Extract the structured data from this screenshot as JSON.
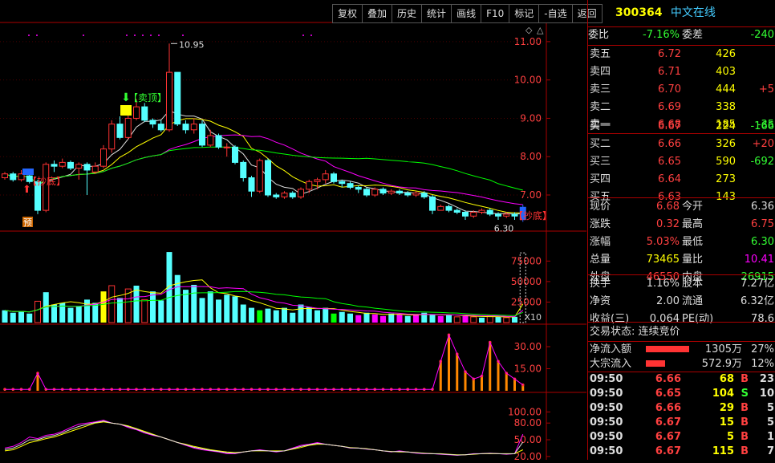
{
  "toolbar": {
    "buttons": [
      "复权",
      "叠加",
      "历史",
      "统计",
      "画线",
      "F10",
      "标记",
      "-自选",
      "返回"
    ]
  },
  "stock": {
    "code": "300364",
    "name": "中文在线"
  },
  "quote": {
    "weibi_label": "委比",
    "weibi_value": "-7.16%",
    "weicha_label": "委差",
    "weicha_value": "-240",
    "asks": [
      {
        "label": "卖五",
        "price": "6.72",
        "volume": "426",
        "change": ""
      },
      {
        "label": "卖四",
        "price": "6.71",
        "volume": "403",
        "change": ""
      },
      {
        "label": "卖三",
        "price": "6.70",
        "volume": "444",
        "change": "+5"
      },
      {
        "label": "卖二",
        "price": "6.69",
        "volume": "338",
        "change": ""
      },
      {
        "label": "卖一",
        "price": "6.68",
        "volume": "185",
        "change": "-35"
      }
    ],
    "bids": [
      {
        "label": "买一",
        "price": "6.67",
        "volume": "224",
        "change": "-166"
      },
      {
        "label": "买二",
        "price": "6.66",
        "volume": "326",
        "change": "+20"
      },
      {
        "label": "买三",
        "price": "6.65",
        "volume": "590",
        "change": "-692"
      },
      {
        "label": "买四",
        "price": "6.64",
        "volume": "273",
        "change": ""
      },
      {
        "label": "买五",
        "price": "6.63",
        "volume": "143",
        "change": ""
      }
    ],
    "stats": [
      {
        "l1": "现价",
        "v1": "6.68",
        "l2": "今开",
        "v2": "6.36"
      },
      {
        "l1": "涨跌",
        "v1": "0.32",
        "l2": "最高",
        "v2": "6.75"
      },
      {
        "l1": "涨幅",
        "v1": "5.03%",
        "l2": "最低",
        "v2": "6.30"
      },
      {
        "l1": "总量",
        "v1": "73465",
        "l2": "量比",
        "v2": "10.41"
      },
      {
        "l1": "外盘",
        "v1": "46550",
        "l2": "内盘",
        "v2": "26915"
      }
    ],
    "fund": [
      {
        "l1": "换手",
        "v1": "1.16%",
        "l2": "股本",
        "v2": "7.27亿"
      },
      {
        "l1": "净资",
        "v1": "2.00",
        "l2": "流通",
        "v2": "6.32亿"
      },
      {
        "l1": "收益(三)",
        "v1": "0.064",
        "l2": "PE(动)",
        "v2": "78.6"
      }
    ],
    "trade_status": "交易状态: 连续竞价",
    "net_inflow_label": "净流入额",
    "net_inflow_value": "1305万",
    "net_inflow_pct": "27%",
    "block_inflow_label": "大宗流入",
    "block_inflow_value": "572.9万",
    "block_inflow_pct": "12%",
    "ticks": [
      {
        "time": "09:50",
        "price": "6.66",
        "volume": "68",
        "side": "B",
        "count": "23"
      },
      {
        "time": "09:50",
        "price": "6.65",
        "volume": "104",
        "side": "S",
        "count": "10"
      },
      {
        "time": "09:50",
        "price": "6.66",
        "volume": "29",
        "side": "B",
        "count": "5"
      },
      {
        "time": "09:50",
        "price": "6.67",
        "volume": "15",
        "side": "B",
        "count": "5"
      },
      {
        "time": "09:50",
        "price": "6.67",
        "volume": "5",
        "side": "B",
        "count": "1"
      },
      {
        "time": "09:50",
        "price": "6.67",
        "volume": "115",
        "side": "B",
        "count": "7"
      }
    ]
  },
  "chart_data": {
    "type": "candlestick",
    "price_ticks": [
      "11.00",
      "10.00",
      "9.00",
      "8.00",
      "7.00"
    ],
    "price_tick_values": [
      11,
      10,
      9,
      8,
      7
    ],
    "price_range": [
      6.1,
      11.5
    ],
    "volume_ticks": [
      "75000",
      "50000",
      "25000"
    ],
    "volume_tick_values": [
      75000,
      50000,
      25000
    ],
    "volume_range": [
      0,
      90000
    ],
    "volume_unit": "X10",
    "flow_ticks": [
      "30.00",
      "15.00"
    ],
    "flow_tick_values": [
      30,
      15
    ],
    "flow_range": [
      0,
      42
    ],
    "osc_ticks": [
      "100.00",
      "80.00",
      "50.00",
      "20.00"
    ],
    "osc_tick_values": [
      100,
      80,
      50,
      20
    ],
    "osc_range": [
      14,
      112
    ],
    "annotations": {
      "high": "10.95",
      "low": "6.30",
      "sell_top": "【卖顶】",
      "buy_bottom_left": "【抄底】",
      "buy_bottom_right": "【抄底】",
      "yu": "预"
    },
    "candles": [
      [
        7.45,
        7.55,
        7.6,
        7.4
      ],
      [
        7.55,
        7.4,
        7.6,
        7.35
      ],
      [
        7.4,
        7.55,
        7.65,
        7.35
      ],
      [
        7.5,
        7.35,
        7.55,
        7.3
      ],
      [
        7.35,
        6.6,
        7.4,
        6.5
      ],
      [
        6.6,
        7.8,
        7.85,
        6.55
      ],
      [
        7.8,
        7.75,
        7.9,
        7.6
      ],
      [
        7.75,
        7.85,
        7.95,
        7.7
      ],
      [
        7.85,
        7.7,
        7.9,
        7.65
      ],
      [
        7.7,
        7.8,
        7.85,
        7.4
      ],
      [
        7.8,
        7.65,
        7.85,
        7.0
      ],
      [
        7.6,
        7.75,
        7.85,
        7.55
      ],
      [
        7.75,
        8.2,
        8.3,
        7.7
      ],
      [
        8.2,
        8.85,
        8.95,
        8.1
      ],
      [
        8.85,
        8.5,
        9.05,
        8.45
      ],
      [
        8.5,
        9.0,
        9.1,
        8.45
      ],
      [
        9.0,
        9.3,
        9.5,
        8.95
      ],
      [
        9.3,
        8.95,
        9.4,
        8.9
      ],
      [
        8.95,
        8.85,
        9.0,
        8.75
      ],
      [
        8.85,
        8.7,
        8.95,
        8.65
      ],
      [
        8.7,
        10.2,
        10.95,
        8.65
      ],
      [
        10.2,
        8.85,
        10.2,
        8.8
      ],
      [
        8.85,
        8.7,
        8.95,
        8.6
      ],
      [
        8.7,
        8.85,
        9.0,
        8.6
      ],
      [
        8.85,
        8.3,
        8.95,
        8.25
      ],
      [
        8.3,
        8.55,
        8.7,
        8.25
      ],
      [
        8.55,
        8.25,
        8.6,
        8.2
      ],
      [
        8.25,
        8.25,
        8.35,
        8.0
      ],
      [
        8.25,
        7.85,
        8.3,
        7.8
      ],
      [
        7.85,
        7.45,
        7.9,
        7.35
      ],
      [
        7.45,
        7.1,
        7.5,
        6.95
      ],
      [
        7.1,
        7.9,
        7.95,
        7.05
      ],
      [
        7.9,
        7.0,
        7.95,
        6.95
      ],
      [
        7.0,
        6.95,
        7.05,
        6.9
      ],
      [
        6.95,
        7.05,
        7.1,
        6.9
      ],
      [
        7.05,
        6.95,
        7.1,
        6.9
      ],
      [
        6.95,
        7.15,
        7.2,
        6.9
      ],
      [
        7.15,
        7.35,
        7.4,
        7.05
      ],
      [
        7.35,
        7.4,
        7.45,
        7.15
      ],
      [
        7.4,
        7.55,
        7.65,
        7.3
      ],
      [
        7.55,
        7.35,
        7.6,
        7.3
      ],
      [
        7.35,
        7.3,
        7.4,
        7.2
      ],
      [
        7.3,
        7.2,
        7.35,
        7.15
      ],
      [
        7.2,
        7.15,
        7.25,
        7.05
      ],
      [
        7.15,
        7.0,
        7.2,
        6.95
      ],
      [
        7.0,
        7.15,
        7.2,
        6.95
      ],
      [
        7.15,
        7.05,
        7.2,
        7.0
      ],
      [
        7.05,
        7.1,
        7.15,
        7.0
      ],
      [
        7.1,
        7.05,
        7.15,
        7.0
      ],
      [
        7.05,
        7.0,
        7.1,
        6.95
      ],
      [
        7.0,
        7.05,
        7.1,
        6.95
      ],
      [
        7.05,
        6.95,
        7.1,
        6.9
      ],
      [
        6.95,
        6.6,
        7.0,
        6.5
      ],
      [
        6.6,
        6.7,
        6.75,
        6.6
      ],
      [
        6.7,
        6.6,
        6.75,
        6.55
      ],
      [
        6.6,
        6.55,
        6.65,
        6.5
      ],
      [
        6.55,
        6.45,
        6.6,
        6.35
      ],
      [
        6.45,
        6.55,
        6.6,
        6.4
      ],
      [
        6.55,
        6.6,
        6.65,
        6.5
      ],
      [
        6.6,
        6.5,
        6.65,
        6.45
      ],
      [
        6.5,
        6.45,
        6.55,
        6.35
      ],
      [
        6.45,
        6.5,
        6.55,
        6.4
      ],
      [
        6.5,
        6.45,
        6.55,
        6.35
      ],
      [
        6.36,
        6.68,
        6.75,
        6.3
      ]
    ],
    "volumes": [
      [
        15000,
        "c"
      ],
      [
        12000,
        "c"
      ],
      [
        14000,
        "c"
      ],
      [
        11000,
        "c"
      ],
      [
        26000,
        "r"
      ],
      [
        37000,
        "c"
      ],
      [
        22000,
        "c"
      ],
      [
        24000,
        "c"
      ],
      [
        18000,
        "c"
      ],
      [
        20000,
        "c"
      ],
      [
        28000,
        "c"
      ],
      [
        24000,
        "c"
      ],
      [
        38000,
        "y"
      ],
      [
        45000,
        "r"
      ],
      [
        30000,
        "c"
      ],
      [
        41000,
        "r"
      ],
      [
        45000,
        "c"
      ],
      [
        28000,
        "r"
      ],
      [
        38000,
        "c"
      ],
      [
        27000,
        "c"
      ],
      [
        86000,
        "c"
      ],
      [
        58000,
        "c"
      ],
      [
        40000,
        "c"
      ],
      [
        46000,
        "c"
      ],
      [
        30000,
        "c"
      ],
      [
        38000,
        "c"
      ],
      [
        28000,
        "c"
      ],
      [
        34000,
        "c"
      ],
      [
        32000,
        "c"
      ],
      [
        22000,
        "c"
      ],
      [
        18000,
        "c"
      ],
      [
        15000,
        "g"
      ],
      [
        17000,
        "c"
      ],
      [
        15000,
        "c"
      ],
      [
        18000,
        "c"
      ],
      [
        12000,
        "c"
      ],
      [
        22000,
        "c"
      ],
      [
        19000,
        "c"
      ],
      [
        15000,
        "c"
      ],
      [
        18000,
        "c"
      ],
      [
        11000,
        "g"
      ],
      [
        13000,
        "c"
      ],
      [
        11000,
        "c"
      ],
      [
        9000,
        "m"
      ],
      [
        12000,
        "c"
      ],
      [
        10000,
        "m"
      ],
      [
        8000,
        "m"
      ],
      [
        11000,
        "c"
      ],
      [
        10000,
        "m"
      ],
      [
        8000,
        "c"
      ],
      [
        9000,
        "m"
      ],
      [
        12000,
        "c"
      ],
      [
        10000,
        "c"
      ],
      [
        8000,
        "m"
      ],
      [
        9000,
        "c"
      ],
      [
        7000,
        "r"
      ],
      [
        8000,
        "m"
      ],
      [
        7000,
        "r"
      ],
      [
        6000,
        "c"
      ],
      [
        8000,
        "r"
      ],
      [
        7000,
        "c"
      ],
      [
        6000,
        "r"
      ],
      [
        7000,
        "c"
      ],
      [
        85000,
        "box"
      ]
    ],
    "flow": [
      1,
      1,
      1,
      1,
      12,
      1,
      1,
      1,
      1,
      1,
      1,
      1,
      1,
      1,
      1,
      1,
      1,
      1,
      1,
      1,
      1,
      1,
      1,
      1,
      1,
      1,
      1,
      1,
      1,
      1,
      1,
      1,
      1,
      1,
      1,
      1,
      1,
      1,
      1,
      1,
      1,
      1,
      1,
      1,
      1,
      1,
      1,
      1,
      1,
      1,
      1,
      1,
      1,
      20,
      38,
      25,
      13,
      8,
      10,
      33,
      20,
      12,
      8,
      4,
      2,
      22
    ],
    "osc_k": [
      35,
      38,
      45,
      55,
      52,
      58,
      60,
      65,
      72,
      78,
      80,
      82,
      85,
      80,
      78,
      72,
      68,
      62,
      58,
      55,
      50,
      45,
      40,
      35,
      32,
      30,
      28,
      25,
      25,
      28,
      30,
      32,
      30,
      28,
      30,
      35,
      40,
      42,
      45,
      42,
      40,
      38,
      35,
      35,
      33,
      32,
      30,
      28,
      30,
      28,
      26,
      25,
      25,
      24,
      23,
      22,
      23,
      25,
      25,
      26,
      25,
      24,
      25,
      60
    ],
    "osc_d": [
      30,
      32,
      38,
      45,
      48,
      52,
      55,
      60,
      65,
      70,
      75,
      80,
      82,
      80,
      78,
      75,
      70,
      65,
      60,
      55,
      50,
      45,
      42,
      38,
      35,
      32,
      30,
      28,
      27,
      28,
      30,
      30,
      30,
      30,
      30,
      33,
      36,
      40,
      42,
      42,
      40,
      38,
      36,
      35,
      34,
      32,
      30,
      29,
      28,
      28,
      27,
      26,
      25,
      25,
      24,
      23,
      23,
      24,
      25,
      25,
      25,
      25,
      25,
      32
    ]
  }
}
